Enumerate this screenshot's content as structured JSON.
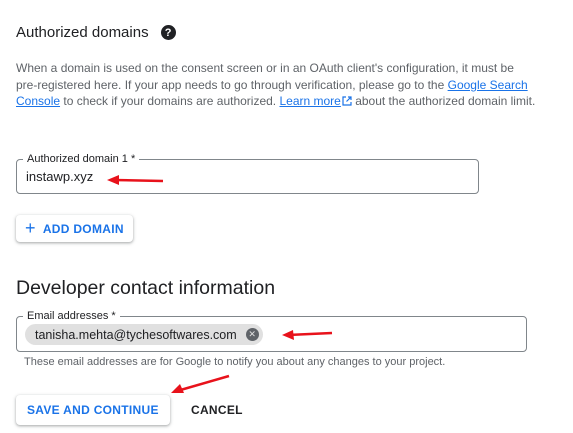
{
  "authorized_domains": {
    "title": "Authorized domains",
    "help_icon": "help-icon",
    "description": {
      "part1": "When a domain is used on the consent screen or in an OAuth client's configuration, it must be pre-registered here. If your app needs to go through verification, please go to the ",
      "link1": "Google Search Console",
      "part2": " to check if your domains are authorized. ",
      "link2": "Learn more",
      "part3": " about the authorized domain limit."
    },
    "domain_field": {
      "label": "Authorized domain 1 *",
      "value": "instawp.xyz"
    },
    "add_domain_label": "ADD DOMAIN",
    "add_icon": "plus-icon"
  },
  "developer_contact": {
    "title": "Developer contact information",
    "email_field": {
      "label": "Email addresses *",
      "chips": [
        "tanisha.mehta@tychesoftwares.com"
      ]
    },
    "hint": "These email addresses are for Google to notify you about any changes to your project."
  },
  "actions": {
    "save_label": "SAVE AND CONTINUE",
    "cancel_label": "CANCEL"
  },
  "colors": {
    "accent": "#1a73e8",
    "annotation_arrow": "#e8121b"
  }
}
